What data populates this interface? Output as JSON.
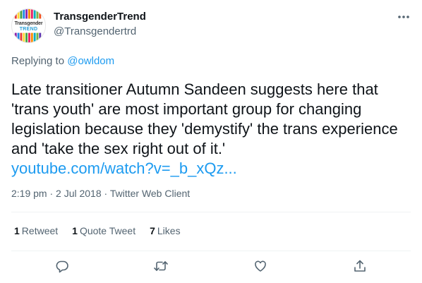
{
  "author": {
    "display_name": "TransgenderTrend",
    "handle": "@Transgendertrd",
    "avatar_label_top": "Transgender",
    "avatar_label_bottom": "TREND"
  },
  "replying": {
    "prefix": "Replying to",
    "mention": "@owldom"
  },
  "tweet": {
    "text": "Late transitioner Autumn Sandeen suggests here that 'trans youth' are most important group for changing legislation because they 'demystify' the trans experience and 'take the sex right out of it.'",
    "link": "youtube.com/watch?v=_b_xQz..."
  },
  "meta": {
    "time": "2:19 pm",
    "date": "2 Jul 2018",
    "client": "Twitter Web Client",
    "full": "2:19 pm · 2 Jul 2018 · Twitter Web Client"
  },
  "stats": {
    "retweets_count": "1",
    "retweets_label": "Retweet",
    "quotes_count": "1",
    "quotes_label": "Quote Tweet",
    "likes_count": "7",
    "likes_label": "Likes"
  },
  "icons": {
    "more": "more-icon",
    "reply": "reply-icon",
    "retweet": "retweet-icon",
    "like": "like-icon",
    "share": "share-icon"
  },
  "colors": {
    "text_primary": "#0f1419",
    "text_secondary": "#536471",
    "link": "#1d9bf0",
    "divider": "#eff3f4"
  }
}
